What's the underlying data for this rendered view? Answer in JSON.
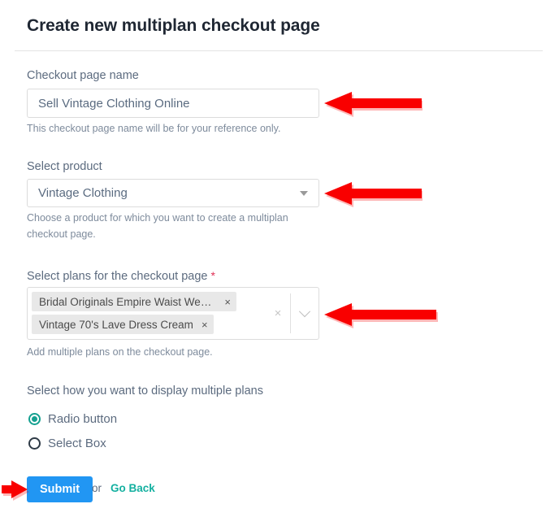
{
  "header": {
    "title": "Create new multiplan checkout page"
  },
  "form": {
    "checkout_name": {
      "label": "Checkout page name",
      "value": "Sell Vintage Clothing Online",
      "placeholder": "Sell Vintage Clothing Online",
      "help": "This checkout page name will be for your reference only."
    },
    "product": {
      "label": "Select product",
      "value": "Vintage Clothing",
      "help": "Choose a product for which you want to create a multiplan checkout page.",
      "caret_icon": "chevron-down-icon"
    },
    "plans": {
      "label": "Select plans for the checkout page",
      "required_marker": "*",
      "help": "Add multiple plans on the checkout page.",
      "tags": [
        {
          "label": "Bridal Originals Empire Waist Wed…",
          "remove_icon": "close-icon",
          "remove_glyph": "×"
        },
        {
          "label": "Vintage 70's Lave Dress Cream",
          "remove_icon": "close-icon",
          "remove_glyph": "×"
        }
      ],
      "clear_all_icon": "clear-all-icon",
      "clear_all_glyph": "×",
      "dropdown_icon": "chevron-down-icon"
    },
    "display_mode": {
      "label": "Select how you want to display multiple plans",
      "options": [
        {
          "label": "Radio button",
          "selected": true
        },
        {
          "label": "Select Box",
          "selected": false
        }
      ]
    }
  },
  "footer": {
    "submit_label": "Submit",
    "or_label": "or",
    "go_back_label": "Go Back"
  },
  "annotations": {
    "arrow_color": "#f90000",
    "arrows": [
      {
        "name": "arrow-to-checkout-name-input",
        "direction": "left"
      },
      {
        "name": "arrow-to-product-select",
        "direction": "left"
      },
      {
        "name": "arrow-to-plans-select",
        "direction": "left"
      },
      {
        "name": "arrow-to-submit-button",
        "direction": "right"
      }
    ]
  },
  "colors": {
    "accent_blue": "#2196f3",
    "accent_teal": "#14a090",
    "required_red": "#e03055",
    "annotation_red": "#f90000",
    "label_gray": "#5c6b7f",
    "help_gray": "#7e8b9c"
  }
}
